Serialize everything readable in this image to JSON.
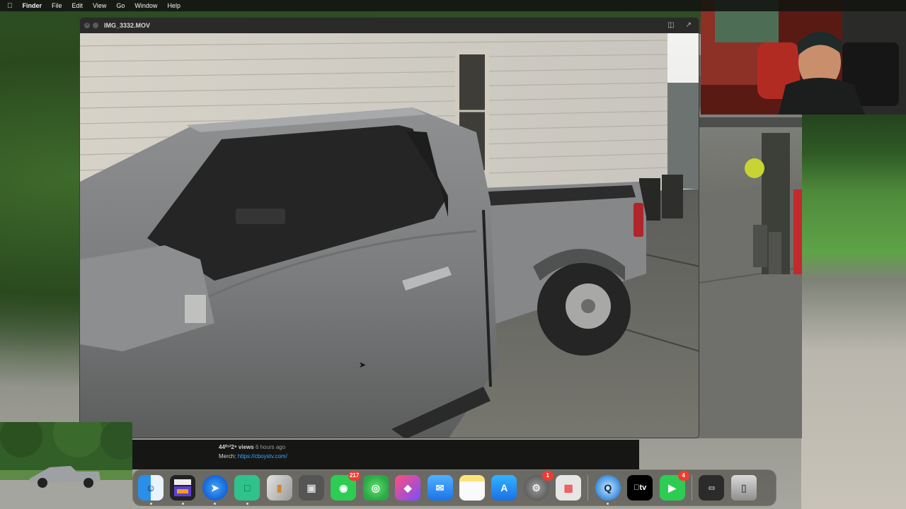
{
  "menubar": {
    "items": [
      "Finder",
      "File",
      "Edit",
      "View",
      "Go",
      "Window",
      "Help"
    ]
  },
  "player": {
    "title": "IMG_3332.MOV"
  },
  "video_info": {
    "views": "44⁰¹²2⁸",
    "views_label": "views",
    "age": "6 hours ago",
    "merch_label": "Merch:",
    "merch_link": "https://cboystv.com/"
  },
  "dock": {
    "apps": [
      {
        "name": "Finder",
        "icon": "finder-icon"
      },
      {
        "name": "Final Cut Pro",
        "icon": "final-cut-icon"
      },
      {
        "name": "Safari",
        "icon": "safari-icon"
      },
      {
        "name": "Streamlabs",
        "icon": "streamlabs-icon"
      },
      {
        "name": "Remote",
        "icon": "remote-icon"
      },
      {
        "name": "Screenshot",
        "icon": "screenshot-icon"
      },
      {
        "name": "Messages",
        "icon": "messages-icon",
        "badge": "217"
      },
      {
        "name": "Find My",
        "icon": "find-my-icon"
      },
      {
        "name": "Shortcuts",
        "icon": "shortcuts-icon"
      },
      {
        "name": "Mail",
        "icon": "mail-icon"
      },
      {
        "name": "Notes",
        "icon": "notes-icon"
      },
      {
        "name": "App Store",
        "icon": "app-store-icon"
      },
      {
        "name": "System Settings",
        "icon": "settings-icon",
        "badge": "1"
      },
      {
        "name": "Launchpad",
        "icon": "launchpad-icon"
      },
      {
        "name": "QuickTime",
        "icon": "quicktime-icon"
      },
      {
        "name": "Apple TV",
        "icon": "apple-tv-icon",
        "label": "tv"
      },
      {
        "name": "FaceTime",
        "icon": "facetime-icon",
        "badge": "4"
      },
      {
        "name": "Recent",
        "icon": "recent-stack-icon"
      },
      {
        "name": "Trash",
        "icon": "trash-icon"
      }
    ]
  },
  "colors": {
    "link": "#3ea6ff",
    "badge": "#f23b2f",
    "truck": "#7d7f80"
  }
}
